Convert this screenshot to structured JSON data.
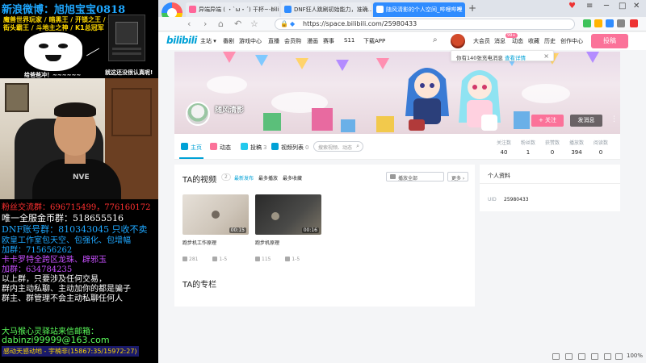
{
  "stream": {
    "weibo": "新浪微博：旭旭宝宝0818",
    "ad_line1": "魔兽世界玩家 / 暗黑王 / 开锁之王 / 开盒王",
    "ad_line2": "街头霸王 / 斗地主之神 / K1总冠军",
    "meme_caption": "给爸爸冲！~~~~~~",
    "game_caption": "就这还没很认真呢!",
    "shirt_text": "NVE",
    "fans_group": "粉丝交流群：696715499，776160172",
    "gold_group": "唯一全服金币群：518655516",
    "dnf_group": "DNF账号群：810343045 只收不卖",
    "eu_line": "欧皇工作室包天空、包强化、包增幅",
    "join1": "加群：715656262",
    "kaka": "卡卡罗特全跨区龙珠、辟邪玉",
    "join2": "加群：634784235",
    "warn1": "以上群，只要涉及任何交易，",
    "warn2": "群内主动私聊、主动加你的都是骗子",
    "warn3": "群主、群管理不会主动私聊任何人",
    "mail1": "大马猴心灵驿站来信邮箱：",
    "mail2": "dabinzi99999@163.com",
    "thanks": "感动天感动地 - 宇楠非(15867:35/15972:27)"
  },
  "browser": {
    "tabs": [
      {
        "label": "异端异端 ( ・`ω・´) 干杯~-bili...",
        "color": "#ff6699"
      },
      {
        "label": "DNF狂人跳刷初始能力，准确...",
        "color": "#2f8cff"
      },
      {
        "label": "随风清影的个人空间_哔哩哔哩",
        "color": "#ffffff"
      }
    ],
    "new_tab": "+",
    "url_secure": "🔒",
    "url": "https://space.bilibili.com/25980433",
    "zoom": "100%"
  },
  "bili": {
    "logo": "bilibili",
    "nav": [
      "主站 ▾",
      "番剧",
      "游戏中心",
      "直播",
      "会员购",
      "漫画",
      "赛事",
      "S11",
      "下载APP"
    ],
    "right": [
      "大会员",
      "消息",
      "动态",
      "收藏",
      "历史",
      "创作中心"
    ],
    "msg_badge": "99+",
    "upload": "投稿",
    "notice": "你有140张充电消息",
    "notice_link": "查看详情",
    "username": "随风清影",
    "follow": "+ 关注",
    "message": "发消息",
    "tabs": [
      {
        "label": "主页",
        "count": ""
      },
      {
        "label": "动态",
        "count": ""
      },
      {
        "label": "投稿",
        "count": "3"
      },
      {
        "label": "视频列表",
        "count": "0"
      }
    ],
    "search_placeholder": "搜索视频、动态",
    "stats": [
      {
        "label": "关注数",
        "value": "40"
      },
      {
        "label": "粉丝数",
        "value": "1"
      },
      {
        "label": "获赞数",
        "value": "0"
      },
      {
        "label": "播放数",
        "value": "394"
      },
      {
        "label": "阅读数",
        "value": "0"
      }
    ],
    "videos_title": "TA的视频",
    "videos_count": "2",
    "sorts": [
      "最新发布",
      "最多播放",
      "最多收藏"
    ],
    "play_all": "播放全部",
    "more": "更多 ›",
    "videos": [
      {
        "title": "跑步机工作原理",
        "duration": "00:15",
        "views": "281",
        "date": "1-5"
      },
      {
        "title": "跑步机原理",
        "duration": "00:16",
        "views": "115",
        "date": "1-5"
      }
    ],
    "column_title": "TA的专栏",
    "profile_title": "个人资料",
    "uid_label": "UID",
    "uid_value": "25980433",
    "accent": "#00a1d6",
    "pink": "#fb7299"
  }
}
